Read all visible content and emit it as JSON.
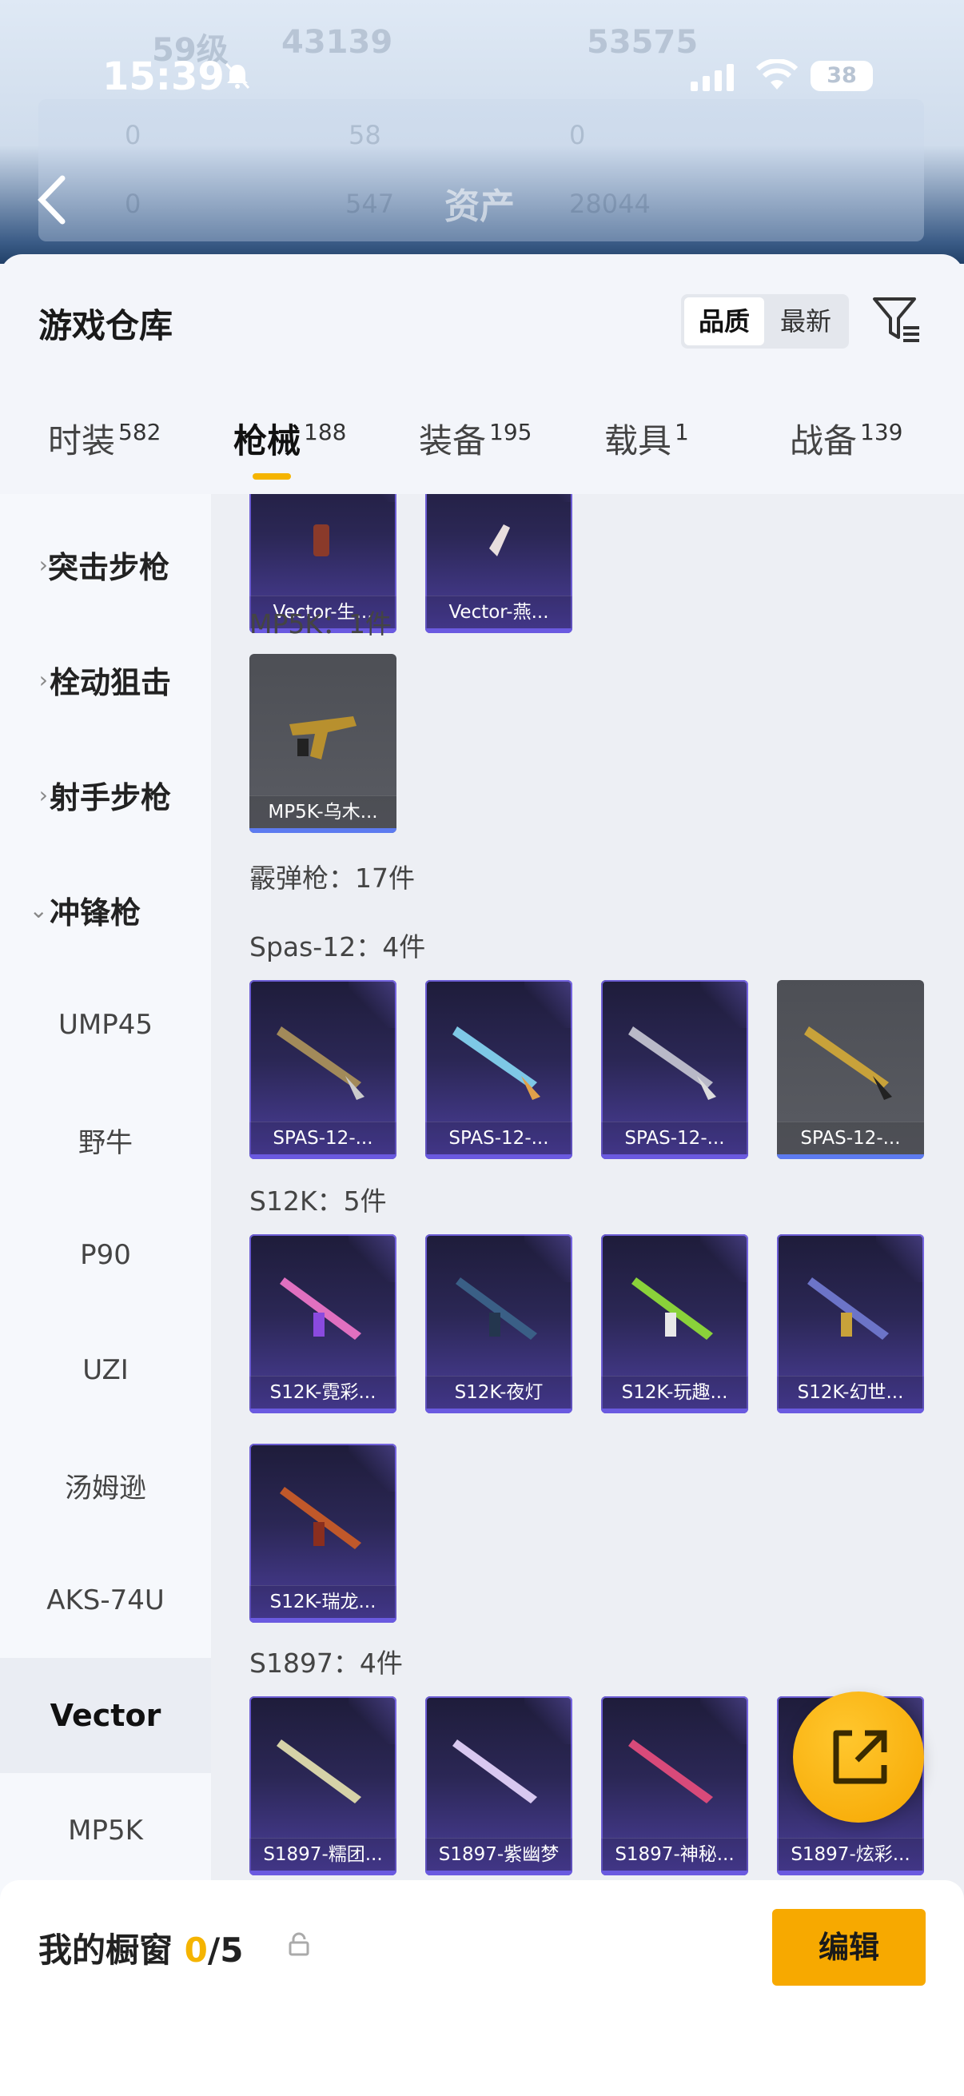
{
  "status_bar": {
    "time": "15:39",
    "battery": "38"
  },
  "background_header": {
    "level": "59级",
    "coins": "43139",
    "score": "53575",
    "title": "资产",
    "row1": [
      "0",
      "58",
      "0"
    ],
    "row2": [
      "0",
      "547",
      "28044"
    ]
  },
  "sheet": {
    "title": "游戏仓库",
    "sort_options": [
      "品质",
      "最新"
    ],
    "active_sort": "品质"
  },
  "tabs": [
    {
      "label": "时装",
      "count": "582"
    },
    {
      "label": "枪械",
      "count": "188"
    },
    {
      "label": "装备",
      "count": "195"
    },
    {
      "label": "载具",
      "count": "1"
    },
    {
      "label": "战备",
      "count": "139"
    }
  ],
  "active_tab": "枪械",
  "sidebar": {
    "categories": [
      "突击步枪",
      "栓动狙击",
      "射手步枪",
      "冲锋枪"
    ],
    "subitems": [
      "UMP45",
      "野牛",
      "P90",
      "UZI",
      "汤姆逊",
      "AKS-74U",
      "Vector",
      "MP5K"
    ],
    "selected": "Vector"
  },
  "content": {
    "vector_items": [
      "Vector-生...",
      "Vector-燕..."
    ],
    "mp5k_label": "MP5K：1件",
    "mp5k_items": [
      "MP5K-乌木..."
    ],
    "shotgun_label": "霰弹枪：17件",
    "spas_label": "Spas-12：4件",
    "spas_items": [
      "SPAS-12-...",
      "SPAS-12-...",
      "SPAS-12-...",
      "SPAS-12-..."
    ],
    "s12k_label": "S12K：5件",
    "s12k_items": [
      "S12K-霓彩...",
      "S12K-夜灯",
      "S12K-玩趣...",
      "S12K-幻世...",
      "S12K-瑞龙..."
    ],
    "s1897_label": "S1897：4件",
    "s1897_items": [
      "S1897-糯团...",
      "S1897-紫幽梦",
      "S1897-神秘...",
      "S1897-炫彩..."
    ]
  },
  "bottom_bar": {
    "showcase_label": "我的橱窗",
    "showcase_count": "0",
    "showcase_total": "/5",
    "edit_label": "编辑"
  },
  "colors": {
    "accent": "#f5b400",
    "card_purple": "#4c3f9d",
    "card_grey": "#5a5c63"
  }
}
